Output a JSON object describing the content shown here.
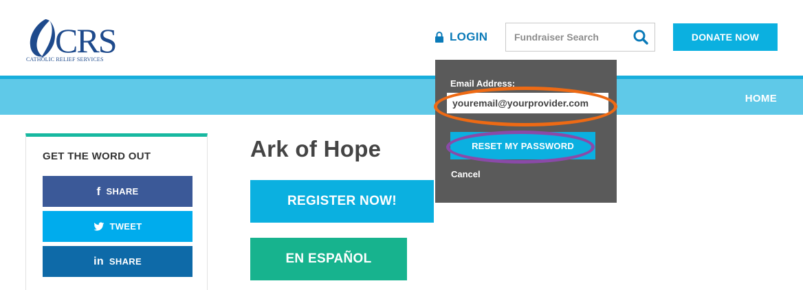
{
  "header": {
    "logo_text": "CRS",
    "logo_subtitle": "CATHOLIC RELIEF SERVICES",
    "login_label": "LOGIN",
    "search": {
      "placeholder": "Fundraiser Search",
      "value": ""
    },
    "donate_label": "DONATE NOW"
  },
  "nav": {
    "items": [
      {
        "label": "HOME"
      }
    ]
  },
  "sidebar": {
    "title": "GET THE WORD OUT",
    "buttons": [
      {
        "icon": "f",
        "label": "SHARE",
        "network": "facebook",
        "color": "#3b5998"
      },
      {
        "icon": "twitter-bird",
        "label": "TWEET",
        "network": "twitter",
        "color": "#00aced"
      },
      {
        "icon": "in",
        "label": "SHARE",
        "network": "linkedin",
        "color": "#0e6aa8"
      }
    ]
  },
  "main": {
    "title": "Ark of Hope",
    "register_label": "REGISTER NOW!",
    "espanol_label": "EN ESPAÑOL"
  },
  "login_dropdown": {
    "email_label": "Email Address:",
    "email_value": "youremail@yourprovider.com",
    "reset_label": "RESET MY PASSWORD",
    "cancel_label": "Cancel"
  },
  "colors": {
    "brand_blue": "#1e4a8c",
    "accent_cyan": "#0bb0e0",
    "nav_bar": "#5fc9e8",
    "teal": "#17b38e",
    "dropdown_bg": "#5a5a5a",
    "highlight_orange": "#ee6a14",
    "highlight_purple": "#8a4aa8"
  }
}
